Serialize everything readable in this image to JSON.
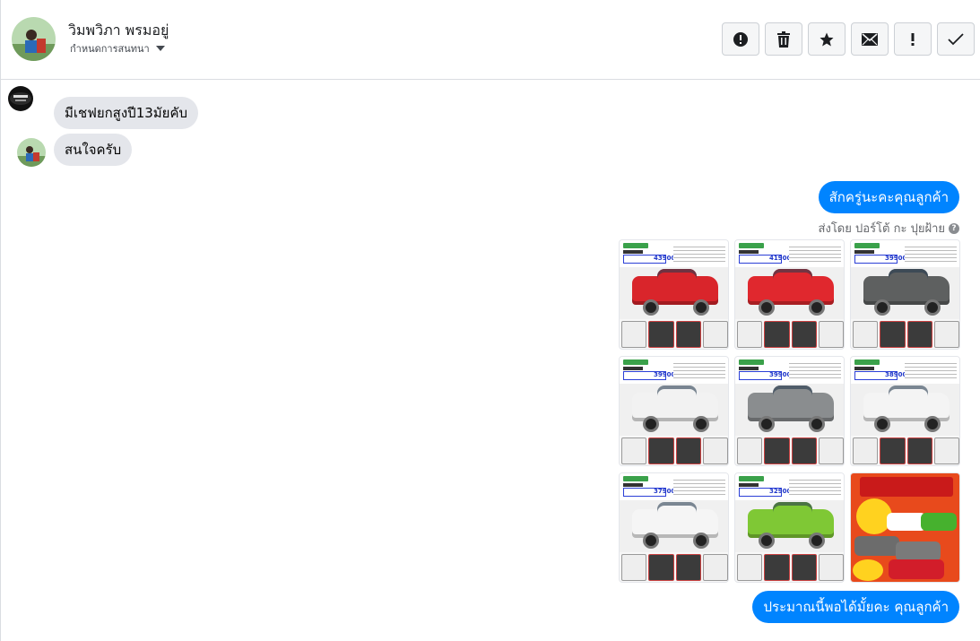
{
  "header": {
    "contact_name": "วิมพวิภา พรมอยู่",
    "subtitle": "กำหนดการสนทนา",
    "actions": [
      {
        "icon": "alert-circle-icon",
        "name": "report-button"
      },
      {
        "icon": "trash-icon",
        "name": "delete-button"
      },
      {
        "icon": "star-icon",
        "name": "star-button"
      },
      {
        "icon": "envelope-icon",
        "name": "mark-unread-button"
      },
      {
        "icon": "exclamation-icon",
        "name": "spam-button"
      },
      {
        "icon": "check-icon",
        "name": "done-button"
      }
    ]
  },
  "messages": [
    {
      "from": "incoming",
      "text": "มีเชฟยกสูงปี13มัยคับ"
    },
    {
      "from": "incoming",
      "text": "สนใจครับ"
    },
    {
      "from": "outgoing",
      "text": "สักครู่นะคะคุณลูกค้า"
    },
    {
      "from": "outgoing",
      "text": "ประมาณนี้พอได้มั้ยคะ คุณลูกค้า"
    }
  ],
  "sent_by": "ส่งโดย ปอร์โต้ กะ ปุยฝ้าย",
  "gallery": {
    "items": [
      {
        "price": "439000",
        "car_color": "#d9252b"
      },
      {
        "price": "419000",
        "car_color": "#e0282e"
      },
      {
        "price": "399000",
        "car_color": "#5e6060"
      },
      {
        "price": "399000",
        "car_color": "#f2f2f2"
      },
      {
        "price": "399000",
        "car_color": "#8a8d8f"
      },
      {
        "price": "389000",
        "car_color": "#f4f4f4"
      },
      {
        "price": "379000",
        "car_color": "#f5f5f5"
      },
      {
        "price": "329000",
        "car_color": "#7fc835"
      }
    ]
  },
  "colors": {
    "accent": "#0084ff",
    "incoming_bubble": "#e4e6eb",
    "promo_bg": "#e84a1c"
  }
}
